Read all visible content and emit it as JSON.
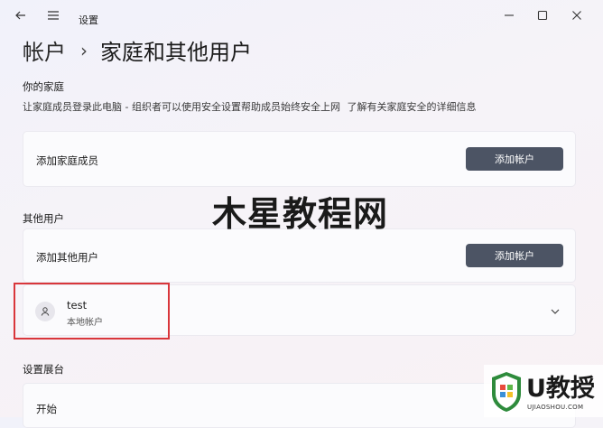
{
  "window": {
    "title": "设置",
    "back_icon": "back-arrow-icon",
    "menu_icon": "hamburger-menu-icon",
    "minimize_icon": "minimize-icon",
    "maximize_icon": "maximize-icon",
    "close_icon": "close-icon"
  },
  "breadcrumb": {
    "parent": "帐户",
    "separator": "›",
    "current": "家庭和其他用户"
  },
  "family": {
    "heading": "你的家庭",
    "description": "让家庭成员登录此电脑 - 组织者可以使用安全设置帮助成员始终安全上网",
    "link": "了解有关家庭安全的详细信息",
    "add_member_label": "添加家庭成员",
    "add_button": "添加帐户"
  },
  "other_users": {
    "heading": "其他用户",
    "add_label": "添加其他用户",
    "add_button": "添加帐户",
    "users": [
      {
        "name": "test",
        "type": "本地帐户",
        "avatar_icon": "person-icon",
        "expand_icon": "chevron-down-icon"
      }
    ]
  },
  "kiosk": {
    "heading": "设置展台",
    "start_label": "开始"
  },
  "watermark": {
    "text": "木星教程网"
  },
  "logo": {
    "text": "U教授",
    "subtext": "UJIAOSHOU.COM"
  },
  "colors": {
    "accent_button": "#4c5464",
    "highlight": "#d9363b",
    "logo_green": "#2e8b3c"
  }
}
